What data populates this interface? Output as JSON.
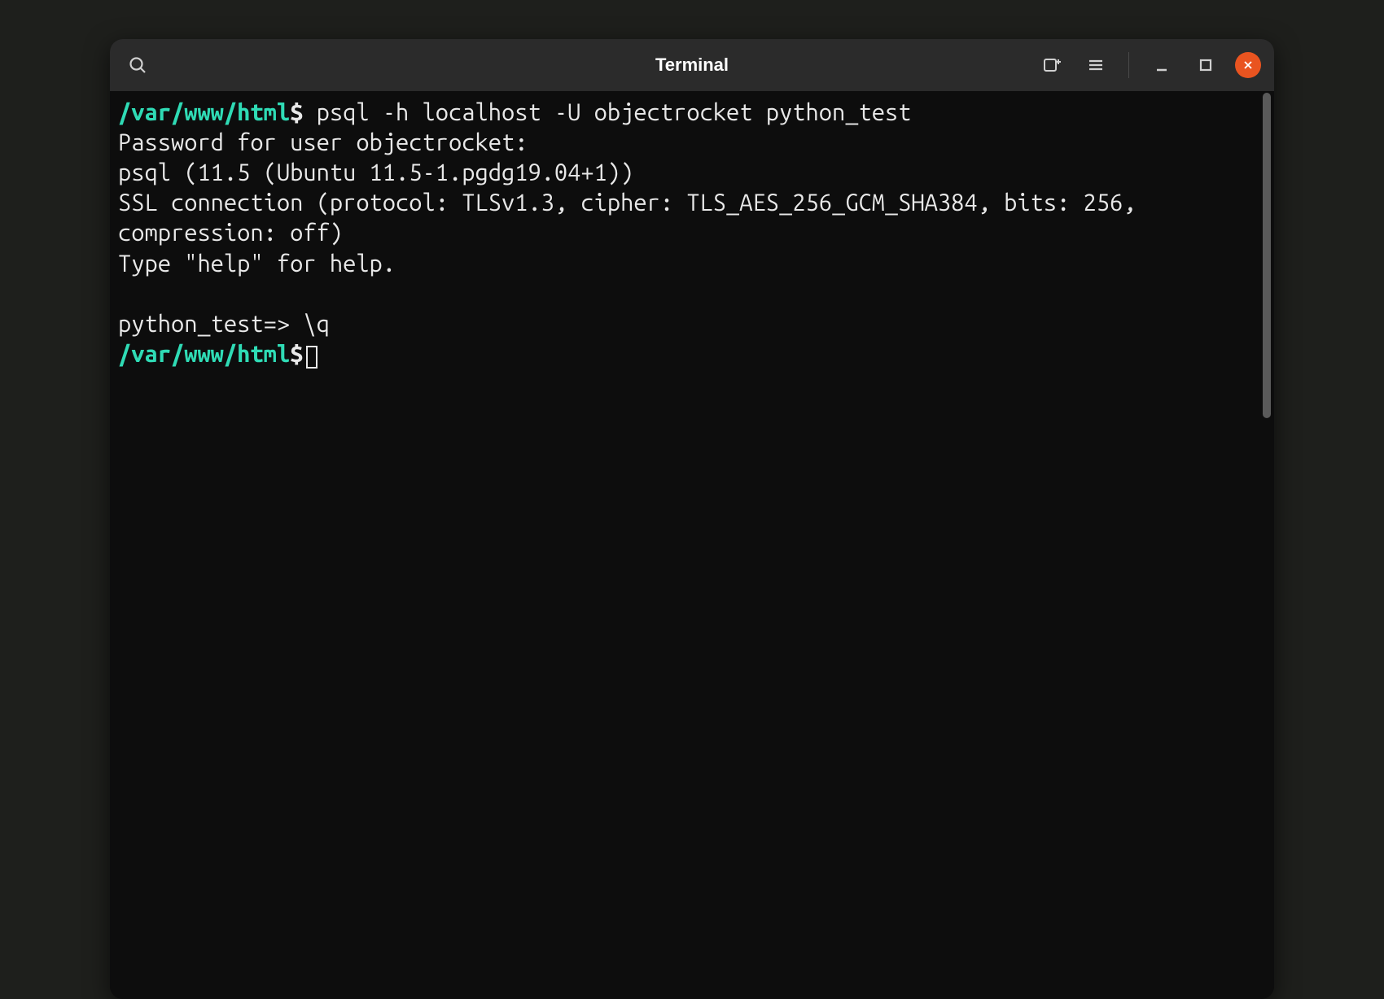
{
  "window": {
    "title": "Terminal"
  },
  "terminal": {
    "lines": [
      {
        "prompt_path": "/var/www/html",
        "prompt_symbol": "$",
        "command": " psql -h localhost -U objectrocket python_test"
      },
      {
        "output": "Password for user objectrocket:"
      },
      {
        "output": "psql (11.5 (Ubuntu 11.5-1.pgdg19.04+1))"
      },
      {
        "output": "SSL connection (protocol: TLSv1.3, cipher: TLS_AES_256_GCM_SHA384, bits: 256, compression: off)"
      },
      {
        "output": "Type \"help\" for help."
      },
      {
        "output": ""
      },
      {
        "output": "python_test=> \\q"
      },
      {
        "prompt_path": "/var/www/html",
        "prompt_symbol": "$",
        "command": "",
        "cursor": true
      }
    ]
  }
}
